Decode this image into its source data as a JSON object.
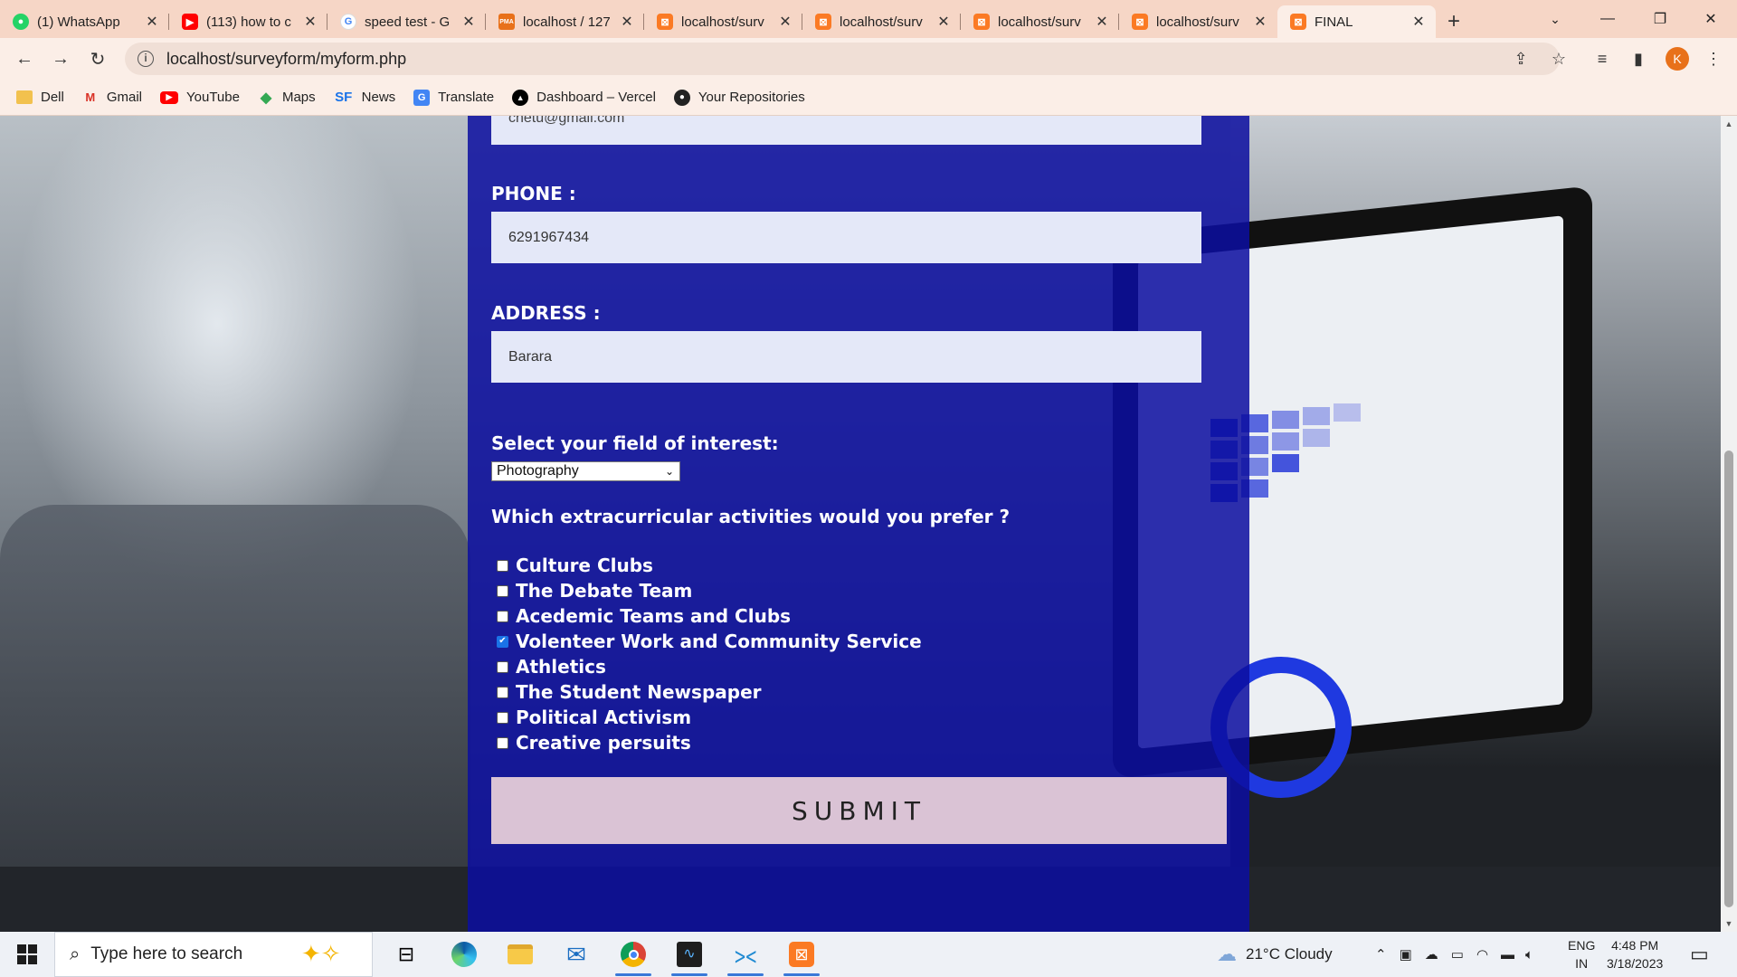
{
  "browser": {
    "tabs": [
      {
        "title": "(1) WhatsApp",
        "favicon": "whatsapp-icon",
        "color": "#25d366",
        "active": false
      },
      {
        "title": "(113) how to c",
        "favicon": "youtube-icon",
        "color": "#ff0000",
        "active": false
      },
      {
        "title": "speed test - G",
        "favicon": "google-icon",
        "color": "#4285f4",
        "active": false
      },
      {
        "title": "localhost / 127",
        "favicon": "phpmyadmin-icon",
        "color": "#e8711a",
        "active": false
      },
      {
        "title": "localhost/surv",
        "favicon": "xampp-icon",
        "color": "#fb7a24",
        "active": false
      },
      {
        "title": "localhost/surv",
        "favicon": "xampp-icon",
        "color": "#fb7a24",
        "active": false
      },
      {
        "title": "localhost/surv",
        "favicon": "xampp-icon",
        "color": "#fb7a24",
        "active": false
      },
      {
        "title": "localhost/surv",
        "favicon": "xampp-icon",
        "color": "#fb7a24",
        "active": false
      },
      {
        "title": "FINAL",
        "favicon": "xampp-icon",
        "color": "#fb7a24",
        "active": true
      }
    ],
    "url": "localhost/surveyform/myform.php",
    "avatar_letter": "K",
    "bookmarks": [
      {
        "label": "Dell",
        "icon": "folder-icon"
      },
      {
        "label": "Gmail",
        "icon": "gmail-icon"
      },
      {
        "label": "YouTube",
        "icon": "youtube-icon"
      },
      {
        "label": "Maps",
        "icon": "maps-icon"
      },
      {
        "label": "News",
        "icon": "news-icon"
      },
      {
        "label": "Translate",
        "icon": "translate-icon"
      },
      {
        "label": "Dashboard – Vercel",
        "icon": "vercel-icon"
      },
      {
        "label": "Your Repositories",
        "icon": "github-icon"
      }
    ]
  },
  "form": {
    "email_value": "chetu@gmail.com",
    "phone_label": "PHONE :",
    "phone_value": "6291967434",
    "address_label": "ADDRESS :",
    "address_value": "Barara",
    "interest_label": "Select your field of interest:",
    "interest_selected": "Photography",
    "activities_label": "Which extracurricular activities would you prefer ?",
    "activities": [
      {
        "label": "Culture Clubs",
        "checked": false
      },
      {
        "label": "The Debate Team",
        "checked": false
      },
      {
        "label": "Acedemic Teams and Clubs",
        "checked": false
      },
      {
        "label": "Volenteer Work and Community Service",
        "checked": true
      },
      {
        "label": "Athletics",
        "checked": false
      },
      {
        "label": "The Student Newspaper",
        "checked": false
      },
      {
        "label": "Political Activism",
        "checked": false
      },
      {
        "label": "Creative persuits",
        "checked": false
      }
    ],
    "submit_label": "SUBMIT"
  },
  "taskbar": {
    "search_placeholder": "Type here to search",
    "weather": "21°C  Cloudy",
    "lang_top": "ENG",
    "lang_bottom": "IN",
    "time": "4:48 PM",
    "date": "3/18/2023"
  },
  "colors": {
    "panel": "#0c0ea0",
    "tabbar": "#f6d6c6",
    "accent": "#1a73e8"
  }
}
